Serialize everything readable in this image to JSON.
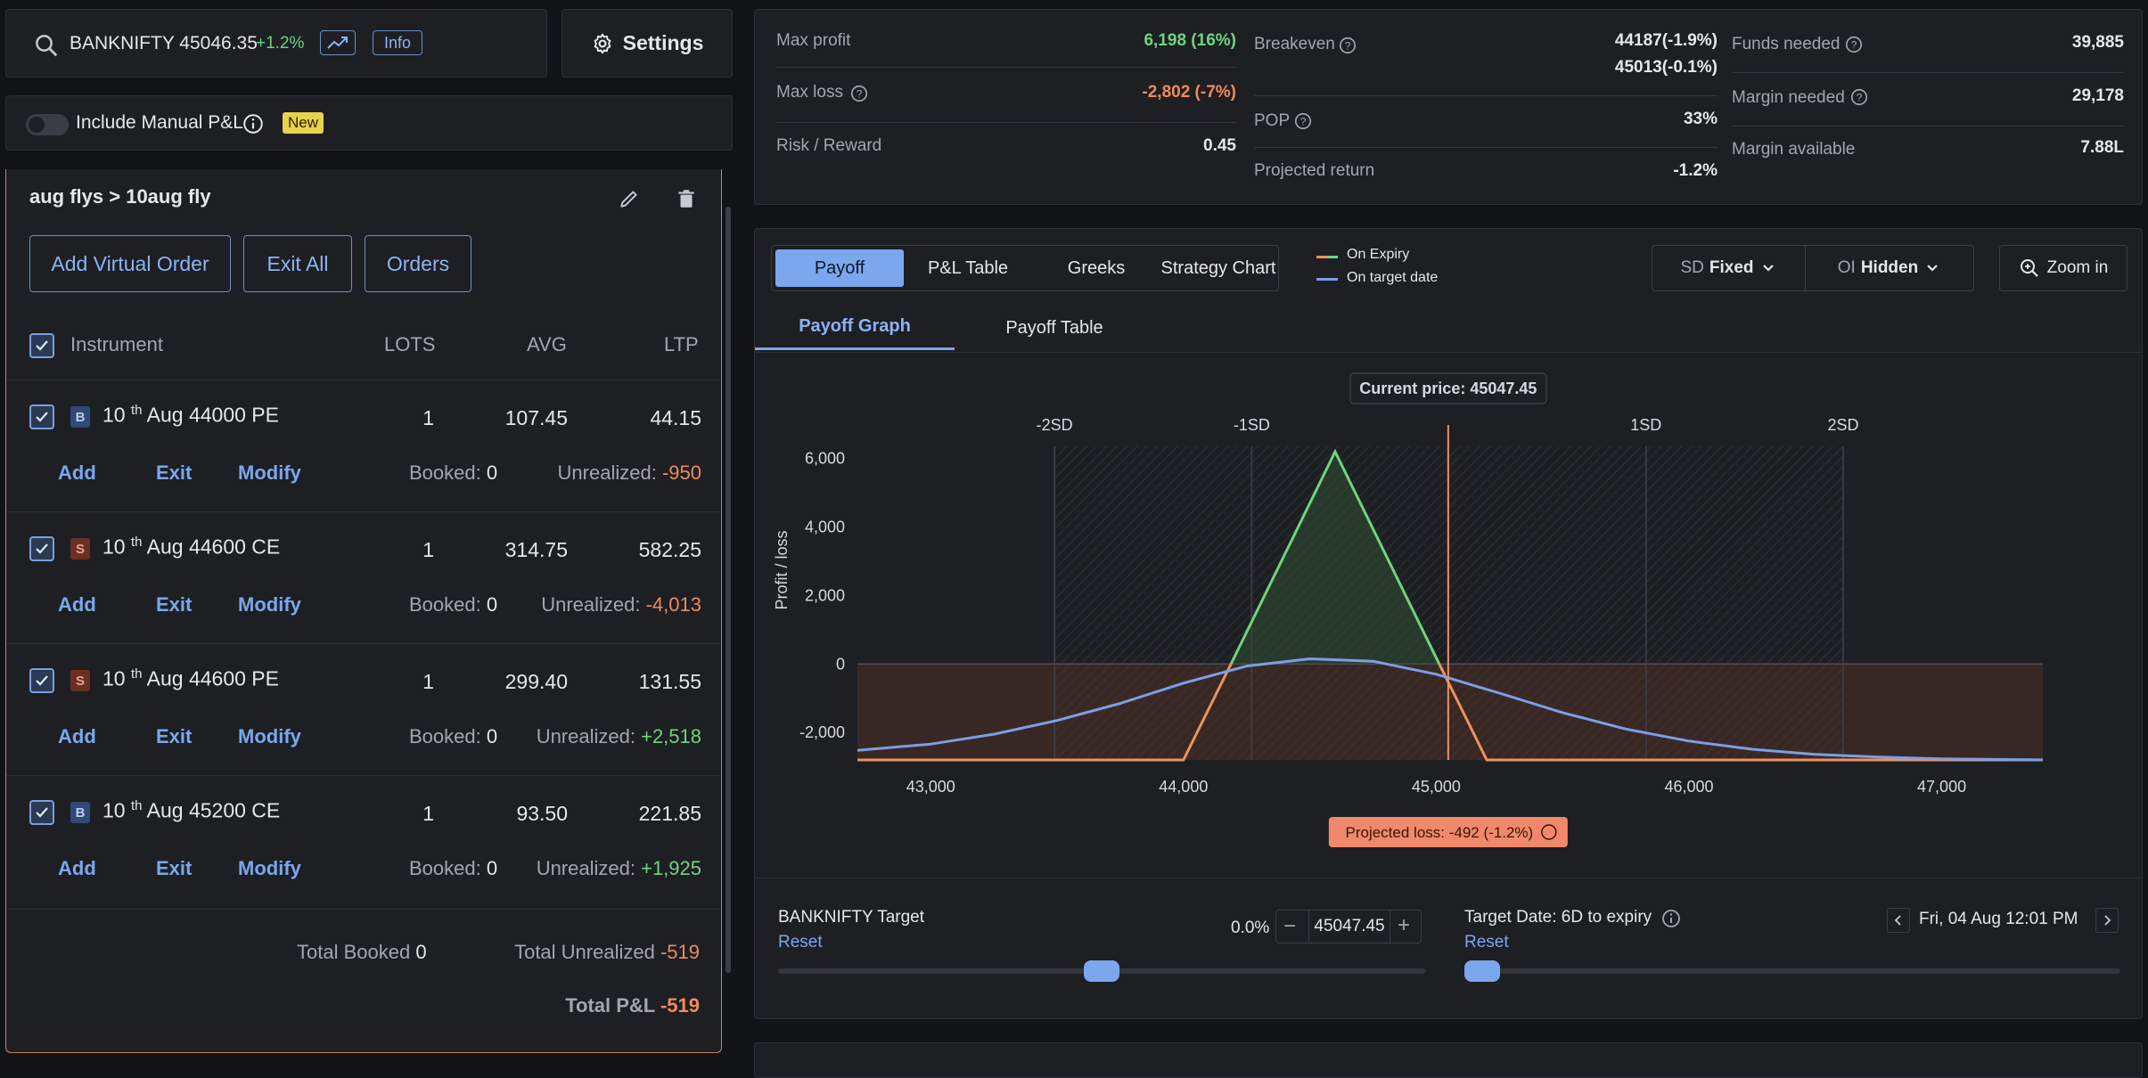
{
  "search": {
    "symbol": "BANKNIFTY 45046.35",
    "change": "+1.2%",
    "info_label": "Info"
  },
  "settings_label": "Settings",
  "manual_pl": {
    "label": "Include Manual P&L",
    "badge": "New"
  },
  "strategy": {
    "title": "aug flys > 10aug fly"
  },
  "buttons": {
    "add_virtual": "Add Virtual Order",
    "exit_all": "Exit All",
    "orders": "Orders"
  },
  "table": {
    "headers": {
      "instrument": "Instrument",
      "lots": "LOTS",
      "avg": "AVG",
      "ltp": "LTP"
    }
  },
  "positions": [
    {
      "side": "B",
      "day": "10",
      "sup": "th",
      "rest": "Aug 44000 PE",
      "lots": "1",
      "avg": "107.45",
      "ltp": "44.15",
      "booked_label": "Booked:",
      "booked": "0",
      "unrl_label": "Unrealized:",
      "unrl": "-950"
    },
    {
      "side": "S",
      "day": "10",
      "sup": "th",
      "rest": "Aug 44600 CE",
      "lots": "1",
      "avg": "314.75",
      "ltp": "582.25",
      "booked_label": "Booked:",
      "booked": "0",
      "unrl_label": "Unrealized:",
      "unrl": "-4,013"
    },
    {
      "side": "S",
      "day": "10",
      "sup": "th",
      "rest": "Aug 44600 PE",
      "lots": "1",
      "avg": "299.40",
      "ltp": "131.55",
      "booked_label": "Booked:",
      "booked": "0",
      "unrl_label": "Unrealized:",
      "unrl": "+2,518"
    },
    {
      "side": "B",
      "day": "10",
      "sup": "th",
      "rest": "Aug 45200 CE",
      "lots": "1",
      "avg": "93.50",
      "ltp": "221.85",
      "booked_label": "Booked:",
      "booked": "0",
      "unrl_label": "Unrealized:",
      "unrl": "+1,925"
    }
  ],
  "row_actions": {
    "add": "Add",
    "exit": "Exit",
    "modify": "Modify"
  },
  "totals": {
    "booked_label": "Total Booked",
    "booked": "0",
    "unrl_label": "Total Unrealized",
    "unrl": "-519",
    "pl_label": "Total P&L",
    "pl": "-519"
  },
  "stats": {
    "max_profit_label": "Max profit",
    "max_profit": "6,198 (16%)",
    "max_loss_label": "Max loss",
    "max_loss": "-2,802 (-7%)",
    "rr_label": "Risk / Reward",
    "rr": "0.45",
    "breakeven_label": "Breakeven",
    "breakeven_1": "44187(-1.9%)",
    "breakeven_2": "45013(-0.1%)",
    "pop_label": "POP",
    "pop": "33%",
    "proj_return_label": "Projected return",
    "proj_return": "-1.2%",
    "funds_label": "Funds needed",
    "funds": "39,885",
    "margin_label": "Margin needed",
    "margin": "29,178",
    "margin_avail_label": "Margin available",
    "margin_avail": "7.88L"
  },
  "tabs": [
    "Payoff",
    "P&L Table",
    "Greeks",
    "Strategy Chart"
  ],
  "legend": {
    "expiry": "On Expiry",
    "target": "On target date"
  },
  "sd_control": {
    "prefix": "SD",
    "value": "Fixed"
  },
  "oi_control": {
    "prefix": "OI",
    "value": "Hidden"
  },
  "zoom_label": "Zoom in",
  "subtabs": [
    "Payoff Graph",
    "Payoff Table"
  ],
  "chart_data": {
    "type": "line",
    "title": "",
    "ylabel": "Profit / loss",
    "xlabel": "",
    "x_ticks": [
      43000,
      44000,
      45000,
      46000,
      47000
    ],
    "x_tick_labels": [
      "43,000",
      "44,000",
      "45,000",
      "46,000",
      "47,000"
    ],
    "y_ticks": [
      -2000,
      0,
      2000,
      4000,
      6000
    ],
    "y_tick_labels": [
      "-2,000",
      "0",
      "2,000",
      "4,000",
      "6,000"
    ],
    "xlim": [
      42710,
      47400
    ],
    "ylim": [
      -2802,
      6198
    ],
    "sd_lines": [
      {
        "label": "-2SD",
        "x": 43490
      },
      {
        "label": "-1SD",
        "x": 44270
      },
      {
        "label": "1SD",
        "x": 45830
      },
      {
        "label": "2SD",
        "x": 46610
      }
    ],
    "current_price_label": "Current price: 45047.45",
    "current_price": 45047.45,
    "projected_label": "Projected loss: -492 (-1.2%)",
    "series": [
      {
        "name": "On Expiry",
        "color": "#6fd47f",
        "loss_color": "#f0905f",
        "x": [
          42710,
          44000,
          44600,
          45200,
          47400
        ],
        "y": [
          -2802,
          -2802,
          6198,
          -2802,
          -2802
        ]
      },
      {
        "name": "On target date",
        "color": "#7b9ee6",
        "x": [
          42710,
          43000,
          43250,
          43500,
          43750,
          44000,
          44250,
          44500,
          44750,
          45000,
          45250,
          45500,
          45750,
          46000,
          46250,
          46500,
          46750,
          47000,
          47400
        ],
        "y": [
          -2520,
          -2340,
          -2050,
          -1650,
          -1150,
          -560,
          -60,
          150,
          80,
          -300,
          -850,
          -1420,
          -1900,
          -2250,
          -2490,
          -2640,
          -2720,
          -2770,
          -2800
        ]
      }
    ]
  },
  "target": {
    "label": "BANKNIFTY Target",
    "reset": "Reset",
    "pct": "0.0%",
    "value": "45047.45",
    "slider_pct": 0.5,
    "date_label": "Target Date:",
    "date_days": "6D",
    "date_suffix": "to expiry",
    "date_reset": "Reset",
    "date_value": "Fri, 04 Aug 12:01 PM",
    "date_slider_pct": 0.0
  }
}
